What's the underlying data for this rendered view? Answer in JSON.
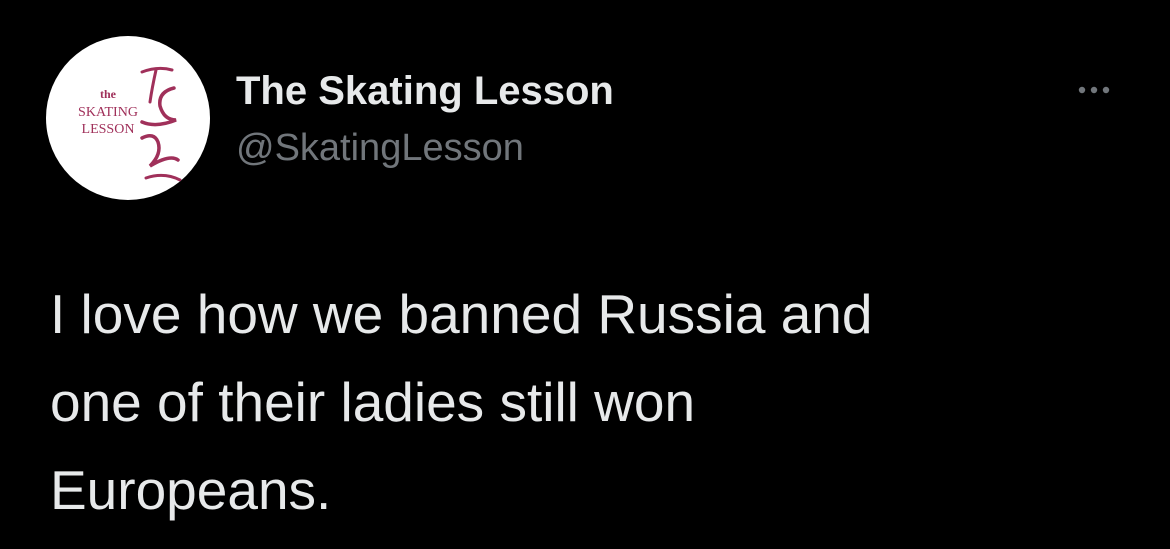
{
  "tweet": {
    "author": {
      "display_name": "The Skating Lesson",
      "handle": "@SkatingLesson",
      "avatar": {
        "icon": "skating-lesson-logo",
        "logo_text_top": "the",
        "logo_text_mid": "SKATING",
        "logo_text_bottom": "LESSON",
        "brand_color": "#a0305a"
      }
    },
    "more_icon": "more-horizontal-icon",
    "text_lines": [
      "I love how we banned Russia and",
      "one of their ladies still won",
      "Europeans."
    ]
  },
  "colors": {
    "background": "#000000",
    "primary_text": "#e7e9ea",
    "secondary_text": "#71767b"
  }
}
